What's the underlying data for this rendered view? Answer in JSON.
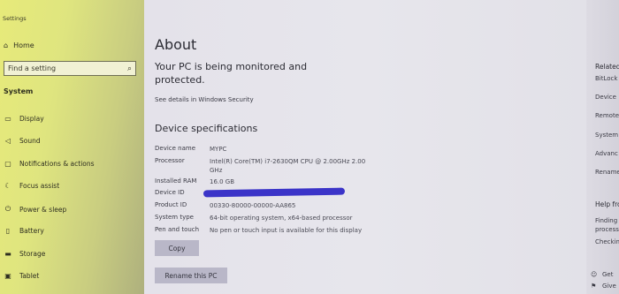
{
  "app": {
    "title": "Settings"
  },
  "sidebar": {
    "home_label": "Home",
    "search": {
      "value": "Find a setting"
    },
    "section": "System",
    "items": [
      {
        "label": "Display",
        "icon": "monitor-icon"
      },
      {
        "label": "Sound",
        "icon": "speaker-icon"
      },
      {
        "label": "Notifications & actions",
        "icon": "notification-icon"
      },
      {
        "label": "Focus assist",
        "icon": "moon-icon"
      },
      {
        "label": "Power & sleep",
        "icon": "power-icon"
      },
      {
        "label": "Battery",
        "icon": "battery-icon"
      },
      {
        "label": "Storage",
        "icon": "storage-icon"
      },
      {
        "label": "Tablet",
        "icon": "tablet-icon"
      }
    ]
  },
  "main": {
    "title": "About",
    "monitor_text": "Your PC is being monitored and protected.",
    "security_link": "See details in Windows Security",
    "spec_title": "Device specifications",
    "specs": [
      {
        "label": "Device name",
        "value": "MYPC"
      },
      {
        "label": "Processor",
        "value": "Intel(R) Core(TM) i7-2630QM CPU @ 2.00GHz   2.00 GHz"
      },
      {
        "label": "Installed RAM",
        "value": "16.0 GB"
      },
      {
        "label": "Device ID",
        "value": ""
      },
      {
        "label": "Product ID",
        "value": "00330-80000-00000-AA865"
      },
      {
        "label": "System type",
        "value": "64-bit operating system, x64-based processor"
      },
      {
        "label": "Pen and touch",
        "value": "No pen or touch input is available for this display"
      }
    ],
    "copy_label": "Copy",
    "rename_label": "Rename this PC"
  },
  "right": {
    "heading": "Related",
    "items": [
      "BitLock",
      "Device",
      "Remote",
      "System",
      "Advanc",
      "Rename"
    ],
    "help_heading": "Help fro",
    "help_text": [
      "Finding",
      "process",
      "Checkin"
    ],
    "get_label": "Get",
    "give_label": "Give"
  }
}
